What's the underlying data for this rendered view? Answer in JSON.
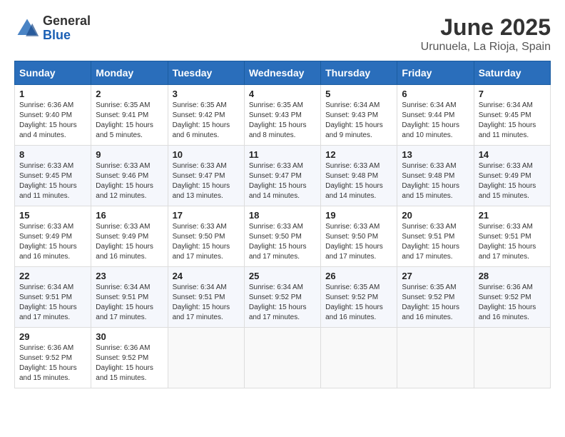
{
  "header": {
    "logo_general": "General",
    "logo_blue": "Blue",
    "title": "June 2025",
    "subtitle": "Urunuela, La Rioja, Spain"
  },
  "columns": [
    "Sunday",
    "Monday",
    "Tuesday",
    "Wednesday",
    "Thursday",
    "Friday",
    "Saturday"
  ],
  "weeks": [
    [
      {
        "day": "1",
        "info": "Sunrise: 6:36 AM\nSunset: 9:40 PM\nDaylight: 15 hours\nand 4 minutes."
      },
      {
        "day": "2",
        "info": "Sunrise: 6:35 AM\nSunset: 9:41 PM\nDaylight: 15 hours\nand 5 minutes."
      },
      {
        "day": "3",
        "info": "Sunrise: 6:35 AM\nSunset: 9:42 PM\nDaylight: 15 hours\nand 6 minutes."
      },
      {
        "day": "4",
        "info": "Sunrise: 6:35 AM\nSunset: 9:43 PM\nDaylight: 15 hours\nand 8 minutes."
      },
      {
        "day": "5",
        "info": "Sunrise: 6:34 AM\nSunset: 9:43 PM\nDaylight: 15 hours\nand 9 minutes."
      },
      {
        "day": "6",
        "info": "Sunrise: 6:34 AM\nSunset: 9:44 PM\nDaylight: 15 hours\nand 10 minutes."
      },
      {
        "day": "7",
        "info": "Sunrise: 6:34 AM\nSunset: 9:45 PM\nDaylight: 15 hours\nand 11 minutes."
      }
    ],
    [
      {
        "day": "8",
        "info": "Sunrise: 6:33 AM\nSunset: 9:45 PM\nDaylight: 15 hours\nand 11 minutes."
      },
      {
        "day": "9",
        "info": "Sunrise: 6:33 AM\nSunset: 9:46 PM\nDaylight: 15 hours\nand 12 minutes."
      },
      {
        "day": "10",
        "info": "Sunrise: 6:33 AM\nSunset: 9:47 PM\nDaylight: 15 hours\nand 13 minutes."
      },
      {
        "day": "11",
        "info": "Sunrise: 6:33 AM\nSunset: 9:47 PM\nDaylight: 15 hours\nand 14 minutes."
      },
      {
        "day": "12",
        "info": "Sunrise: 6:33 AM\nSunset: 9:48 PM\nDaylight: 15 hours\nand 14 minutes."
      },
      {
        "day": "13",
        "info": "Sunrise: 6:33 AM\nSunset: 9:48 PM\nDaylight: 15 hours\nand 15 minutes."
      },
      {
        "day": "14",
        "info": "Sunrise: 6:33 AM\nSunset: 9:49 PM\nDaylight: 15 hours\nand 15 minutes."
      }
    ],
    [
      {
        "day": "15",
        "info": "Sunrise: 6:33 AM\nSunset: 9:49 PM\nDaylight: 15 hours\nand 16 minutes."
      },
      {
        "day": "16",
        "info": "Sunrise: 6:33 AM\nSunset: 9:49 PM\nDaylight: 15 hours\nand 16 minutes."
      },
      {
        "day": "17",
        "info": "Sunrise: 6:33 AM\nSunset: 9:50 PM\nDaylight: 15 hours\nand 17 minutes."
      },
      {
        "day": "18",
        "info": "Sunrise: 6:33 AM\nSunset: 9:50 PM\nDaylight: 15 hours\nand 17 minutes."
      },
      {
        "day": "19",
        "info": "Sunrise: 6:33 AM\nSunset: 9:50 PM\nDaylight: 15 hours\nand 17 minutes."
      },
      {
        "day": "20",
        "info": "Sunrise: 6:33 AM\nSunset: 9:51 PM\nDaylight: 15 hours\nand 17 minutes."
      },
      {
        "day": "21",
        "info": "Sunrise: 6:33 AM\nSunset: 9:51 PM\nDaylight: 15 hours\nand 17 minutes."
      }
    ],
    [
      {
        "day": "22",
        "info": "Sunrise: 6:34 AM\nSunset: 9:51 PM\nDaylight: 15 hours\nand 17 minutes."
      },
      {
        "day": "23",
        "info": "Sunrise: 6:34 AM\nSunset: 9:51 PM\nDaylight: 15 hours\nand 17 minutes."
      },
      {
        "day": "24",
        "info": "Sunrise: 6:34 AM\nSunset: 9:51 PM\nDaylight: 15 hours\nand 17 minutes."
      },
      {
        "day": "25",
        "info": "Sunrise: 6:34 AM\nSunset: 9:52 PM\nDaylight: 15 hours\nand 17 minutes."
      },
      {
        "day": "26",
        "info": "Sunrise: 6:35 AM\nSunset: 9:52 PM\nDaylight: 15 hours\nand 16 minutes."
      },
      {
        "day": "27",
        "info": "Sunrise: 6:35 AM\nSunset: 9:52 PM\nDaylight: 15 hours\nand 16 minutes."
      },
      {
        "day": "28",
        "info": "Sunrise: 6:36 AM\nSunset: 9:52 PM\nDaylight: 15 hours\nand 16 minutes."
      }
    ],
    [
      {
        "day": "29",
        "info": "Sunrise: 6:36 AM\nSunset: 9:52 PM\nDaylight: 15 hours\nand 15 minutes."
      },
      {
        "day": "30",
        "info": "Sunrise: 6:36 AM\nSunset: 9:52 PM\nDaylight: 15 hours\nand 15 minutes."
      },
      {
        "day": "",
        "info": ""
      },
      {
        "day": "",
        "info": ""
      },
      {
        "day": "",
        "info": ""
      },
      {
        "day": "",
        "info": ""
      },
      {
        "day": "",
        "info": ""
      }
    ]
  ]
}
